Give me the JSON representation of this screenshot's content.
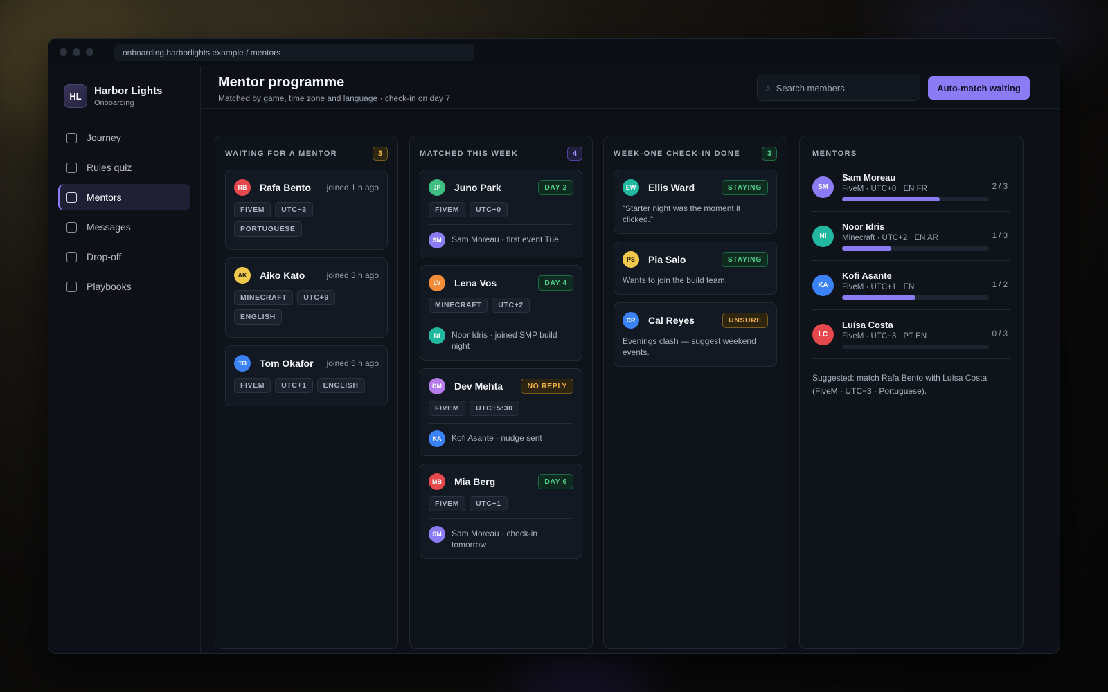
{
  "browser": {
    "url": "onboarding.harborlights.example / mentors"
  },
  "brand": {
    "logo": "HL",
    "name": "Harbor Lights",
    "sub": "Onboarding"
  },
  "nav": [
    {
      "label": "Journey",
      "icon": "square-icon"
    },
    {
      "label": "Rules quiz",
      "icon": "square-icon"
    },
    {
      "label": "Mentors",
      "icon": "square-icon",
      "active": true
    },
    {
      "label": "Messages",
      "icon": "square-icon"
    },
    {
      "label": "Drop-off",
      "icon": "square-icon"
    },
    {
      "label": "Playbooks",
      "icon": "square-icon"
    }
  ],
  "header": {
    "title": "Mentor programme",
    "subtitle": "Matched by game, time zone and language · check-in on day 7",
    "search_placeholder": "Search members",
    "search_icon": "⌕",
    "automatch_label": "Auto-match waiting"
  },
  "colors": {
    "accent": "#8b7cf6",
    "green": "#4fd08d",
    "amber": "#f0b245"
  },
  "columns": {
    "waiting": {
      "title": "WAITING FOR A MENTOR",
      "count": "3",
      "cards": [
        {
          "initials": "RB",
          "avatar_color": "#e5484d",
          "name": "Rafa Bento",
          "meta": "joined 1 h ago",
          "tags": [
            "FIVEM",
            "UTC−3",
            "PORTUGUESE"
          ]
        },
        {
          "initials": "AK",
          "avatar_color": "#f2c94c",
          "name": "Aiko Kato",
          "meta": "joined 3 h ago",
          "tags": [
            "MINECRAFT",
            "UTC+9",
            "ENGLISH"
          ]
        },
        {
          "initials": "TO",
          "avatar_color": "#3b82f6",
          "name": "Tom Okafor",
          "meta": "joined 5 h ago",
          "tags": [
            "FIVEM",
            "UTC+1",
            "ENGLISH"
          ]
        }
      ]
    },
    "matched": {
      "title": "MATCHED THIS WEEK",
      "count": "4",
      "cards": [
        {
          "initials": "JP",
          "avatar_color": "#3fbf7f",
          "name": "Juno Park",
          "status": "DAY 2",
          "tags": [
            "FIVEM",
            "UTC+0"
          ],
          "mentor_initials": "SM",
          "mentor_color": "#8b7cf6",
          "foot": "Sam Moreau · first event Tue"
        },
        {
          "initials": "LV",
          "avatar_color": "#f28c38",
          "name": "Lena Vos",
          "status": "DAY 4",
          "tags": [
            "MINECRAFT",
            "UTC+2"
          ],
          "mentor_initials": "NI",
          "mentor_color": "#22b8a0",
          "foot": "Noor Idris · joined SMP build night"
        },
        {
          "initials": "DM",
          "avatar_color": "#b57be8",
          "name": "Dev Mehta",
          "status": "NO REPLY",
          "tags": [
            "FIVEM",
            "UTC+5:30"
          ],
          "mentor_initials": "KA",
          "mentor_color": "#3b82f6",
          "foot": "Kofi Asante · nudge sent"
        },
        {
          "initials": "MB",
          "avatar_color": "#e5484d",
          "name": "Mia Berg",
          "status": "DAY 6",
          "tags": [
            "FIVEM",
            "UTC+1"
          ],
          "mentor_initials": "SM",
          "mentor_color": "#8b7cf6",
          "foot": "Sam Moreau · check-in tomorrow"
        }
      ]
    },
    "checkin": {
      "title": "WEEK-ONE CHECK-IN DONE",
      "count": "3",
      "cards": [
        {
          "initials": "EW",
          "avatar_color": "#22b8a0",
          "name": "Ellis Ward",
          "status": "STAYING",
          "note": "“Starter night was the moment it clicked.”"
        },
        {
          "initials": "PS",
          "avatar_color": "#f2c94c",
          "name": "Pia Salo",
          "status": "STAYING",
          "note": "Wants to join the build team."
        },
        {
          "initials": "CR",
          "avatar_color": "#3b82f6",
          "name": "Cal Reyes",
          "status": "UNSURE",
          "note": "Evenings clash — suggest weekend events."
        }
      ]
    },
    "mentors": {
      "title": "MENTORS",
      "list": [
        {
          "initials": "SM",
          "avatar_color": "#8b7cf6",
          "name": "Sam Moreau",
          "meta": "FiveM · UTC+0 · EN FR",
          "load": "2 / 3",
          "fill": 0.667
        },
        {
          "initials": "NI",
          "avatar_color": "#22b8a0",
          "name": "Noor Idris",
          "meta": "Minecraft · UTC+2 · EN AR",
          "load": "1 / 3",
          "fill": 0.333
        },
        {
          "initials": "KA",
          "avatar_color": "#3b82f6",
          "name": "Kofi Asante",
          "meta": "FiveM · UTC+1 · EN",
          "load": "1 / 2",
          "fill": 0.5
        },
        {
          "initials": "LC",
          "avatar_color": "#e5484d",
          "name": "Luísa Costa",
          "meta": "FiveM · UTC−3 · PT EN",
          "load": "0 / 3",
          "fill": 0
        }
      ],
      "suggestion": "Suggested: match Rafa Bento with Luísa Costa (FiveM · UTC−3 · Portuguese)."
    }
  }
}
